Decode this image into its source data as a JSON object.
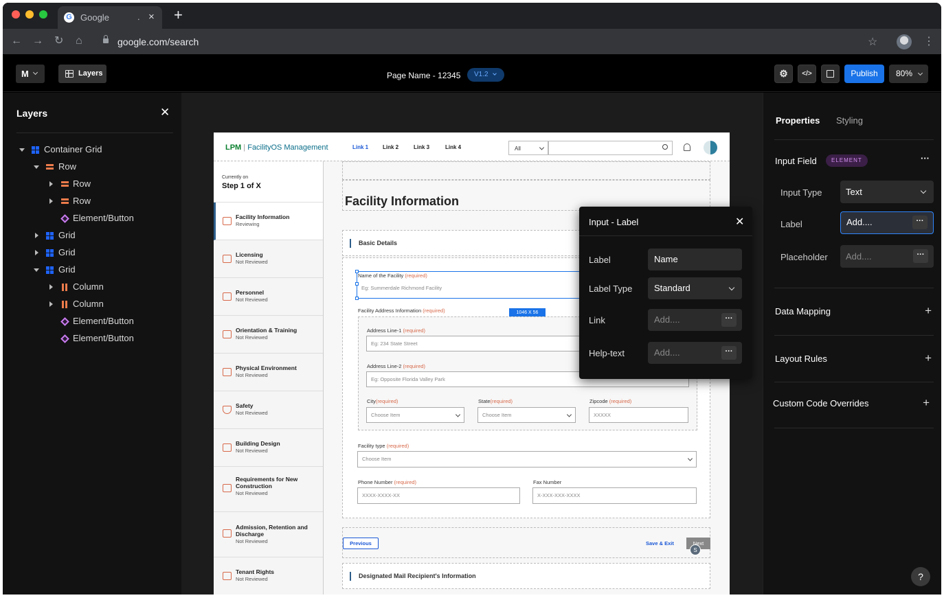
{
  "browser": {
    "tab_title": "Google",
    "tab_dots": ".",
    "tab_close": "×",
    "new_tab": "+",
    "url": "google.com/search",
    "back": "←",
    "forward": "→",
    "reload": "↻",
    "home": "⌂",
    "star": "☆",
    "menu": "⋮"
  },
  "appbar": {
    "mode_label": "M",
    "layers_label": "Layers",
    "page_name": "Page Name - 12345",
    "version": "V1.2",
    "publish": "Publish",
    "zoom": "80%",
    "code_icon": "</>"
  },
  "layers": {
    "title": "Layers",
    "close": "✕",
    "items": [
      {
        "label": "Container Grid",
        "icon": "grid-icon"
      },
      {
        "label": "Row",
        "icon": "row-icon"
      },
      {
        "label": "Row",
        "icon": "row-icon"
      },
      {
        "label": "Row",
        "icon": "row-icon"
      },
      {
        "label": "Element/Button",
        "icon": "element-icon"
      },
      {
        "label": "Grid",
        "icon": "grid-icon"
      },
      {
        "label": "Grid",
        "icon": "grid-icon"
      },
      {
        "label": "Grid",
        "icon": "grid-icon"
      },
      {
        "label": "Column",
        "icon": "column-icon"
      },
      {
        "label": "Column",
        "icon": "column-icon"
      },
      {
        "label": "Element/Button",
        "icon": "element-icon"
      },
      {
        "label": "Element/Button",
        "icon": "element-icon"
      }
    ]
  },
  "preview": {
    "logo_lpm": "LPM",
    "logo_sep": "|",
    "logo_name": "FacilityOS Management",
    "links": [
      "Link 1",
      "Link 2",
      "Link 3",
      "Link 4"
    ],
    "search_filter": "All",
    "current_small": "Currently on",
    "current_big": "Step 1 of X",
    "steps": [
      {
        "name": "Facility Information",
        "status": "Reviewing"
      },
      {
        "name": "Licensing",
        "status": "Not Reviewed"
      },
      {
        "name": "Personnel",
        "status": "Not Reviewed"
      },
      {
        "name": "Orientation & Training",
        "status": "Not Reviewed"
      },
      {
        "name": "Physical Environment",
        "status": "Not Reviewed"
      },
      {
        "name": "Safety",
        "status": "Not Reviewed"
      },
      {
        "name": "Building Design",
        "status": "Not Reviewed"
      },
      {
        "name": "Requirements for New Construction",
        "status": "Not Reviewed"
      },
      {
        "name": "Admission, Retention and Discharge",
        "status": "Not Reviewed"
      },
      {
        "name": "Tenant Rights",
        "status": "Not Reviewed"
      }
    ],
    "form_title": "Facility Information",
    "section_basic": "Basic Details",
    "required": "(required)",
    "facility_name_label": "Name of the Facility",
    "facility_name_ph": "Eg: Summerdale Richmond Facility",
    "address_label": "Facility Address Information",
    "addr1_label": "Address Line-1",
    "addr1_ph": "Eg: 234 State Street",
    "addr2_label": "Address Line-2",
    "addr2_ph": "Eg: Opposite Florida Valley Park",
    "city_label": "City",
    "state_label": "State",
    "zip_label": "Zipcode",
    "choose_item": "Choose Item",
    "zip_ph": "XXXXX",
    "type_label": "Facility type",
    "phone_label": "Phone Number",
    "phone_ph": "XXXX-XXXX-XX",
    "fax_label": "Fax Number",
    "fax_ph": "X-XXX-XXX-XXXX",
    "dim_badge": "1046 X 56",
    "prev": "Previous",
    "save_exit": "Save & Exit",
    "next": "Next",
    "avatar_letter": "S",
    "section_mail": "Designated Mail Recipient's Information"
  },
  "popup": {
    "title": "Input - Label",
    "close": "✕",
    "label_label": "Label",
    "label_value": "Name",
    "type_label": "Label Type",
    "type_value": "Standard",
    "link_label": "Link",
    "link_ph": "Add....",
    "help_label": "Help-text",
    "help_ph": "Add....",
    "dots": "···"
  },
  "properties": {
    "tab_properties": "Properties",
    "tab_styling": "Styling",
    "section": "Input Field",
    "badge": "ELEMENT",
    "more": "···",
    "input_type_label": "Input Type",
    "input_type_value": "Text",
    "label_label": "Label",
    "label_value": "Add....",
    "placeholder_label": "Placeholder",
    "placeholder_value": "Add....",
    "data_mapping": "Data Mapping",
    "layout_rules": "Layout Rules",
    "custom_code": "Custom Code Overrides",
    "plus": "+",
    "help": "?"
  },
  "colors": {
    "accent": "#1a73e8",
    "required": "#d7694a",
    "element_purple": "#c97bf0",
    "grid_blue": "#1e63ff",
    "row_orange": "#ec7b4b"
  }
}
